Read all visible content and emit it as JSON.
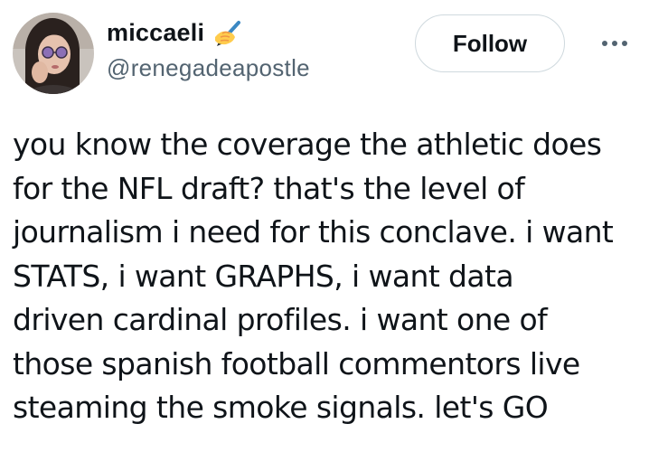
{
  "author": {
    "display_name": "miccaeli",
    "name_emoji": "writing-hand-emoji",
    "handle": "@renegadeapostle",
    "avatar": "profile-photo"
  },
  "actions": {
    "follow_label": "Follow",
    "more_icon": "more-horizontal-icon"
  },
  "tweet": {
    "text": "you know the coverage the athletic does\nfor the NFL draft? that's the level of\njournalism i need for this conclave. i want\nSTATS, i want GRAPHS, i want data\ndriven cardinal profiles. i want one of\nthose spanish football commentors live\nsteaming the smoke signals. let's GO"
  },
  "colors": {
    "text_primary": "#0f1419",
    "text_secondary": "#536471",
    "button_border": "#cfd9de",
    "background": "#ffffff"
  }
}
